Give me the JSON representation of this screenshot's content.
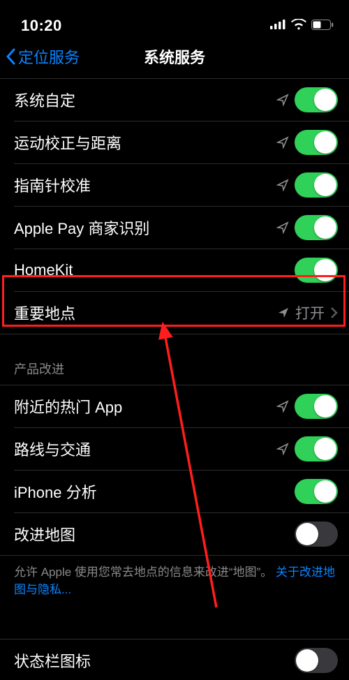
{
  "statusbar": {
    "time": "10:20"
  },
  "nav": {
    "back_label": "定位服务",
    "title": "系统服务"
  },
  "group1": {
    "items": [
      {
        "label": "系统自定",
        "toggle": true,
        "arrow": "outline"
      },
      {
        "label": "运动校正与距离",
        "toggle": true,
        "arrow": "outline"
      },
      {
        "label": "指南针校准",
        "toggle": true,
        "arrow": "outline"
      },
      {
        "label": "Apple Pay 商家识别",
        "toggle": true,
        "arrow": "outline"
      },
      {
        "label": "HomeKit",
        "toggle": true,
        "arrow": "none"
      }
    ],
    "link": {
      "label": "重要地点",
      "status": "打开"
    }
  },
  "group2": {
    "header": "产品改进",
    "items": [
      {
        "label": "附近的热门 App",
        "toggle": true,
        "arrow": "outline"
      },
      {
        "label": "路线与交通",
        "toggle": true,
        "arrow": "outline"
      },
      {
        "label": "iPhone 分析",
        "toggle": true,
        "arrow": "none"
      },
      {
        "label": "改进地图",
        "toggle": false,
        "arrow": "none"
      }
    ],
    "footer_text": "允许 Apple 使用您常去地点的信息来改进“地图”。",
    "footer_link": "关于改进地图与隐私..."
  },
  "group3": {
    "items": [
      {
        "label": "状态栏图标",
        "toggle": false,
        "arrow": "none"
      }
    ]
  }
}
